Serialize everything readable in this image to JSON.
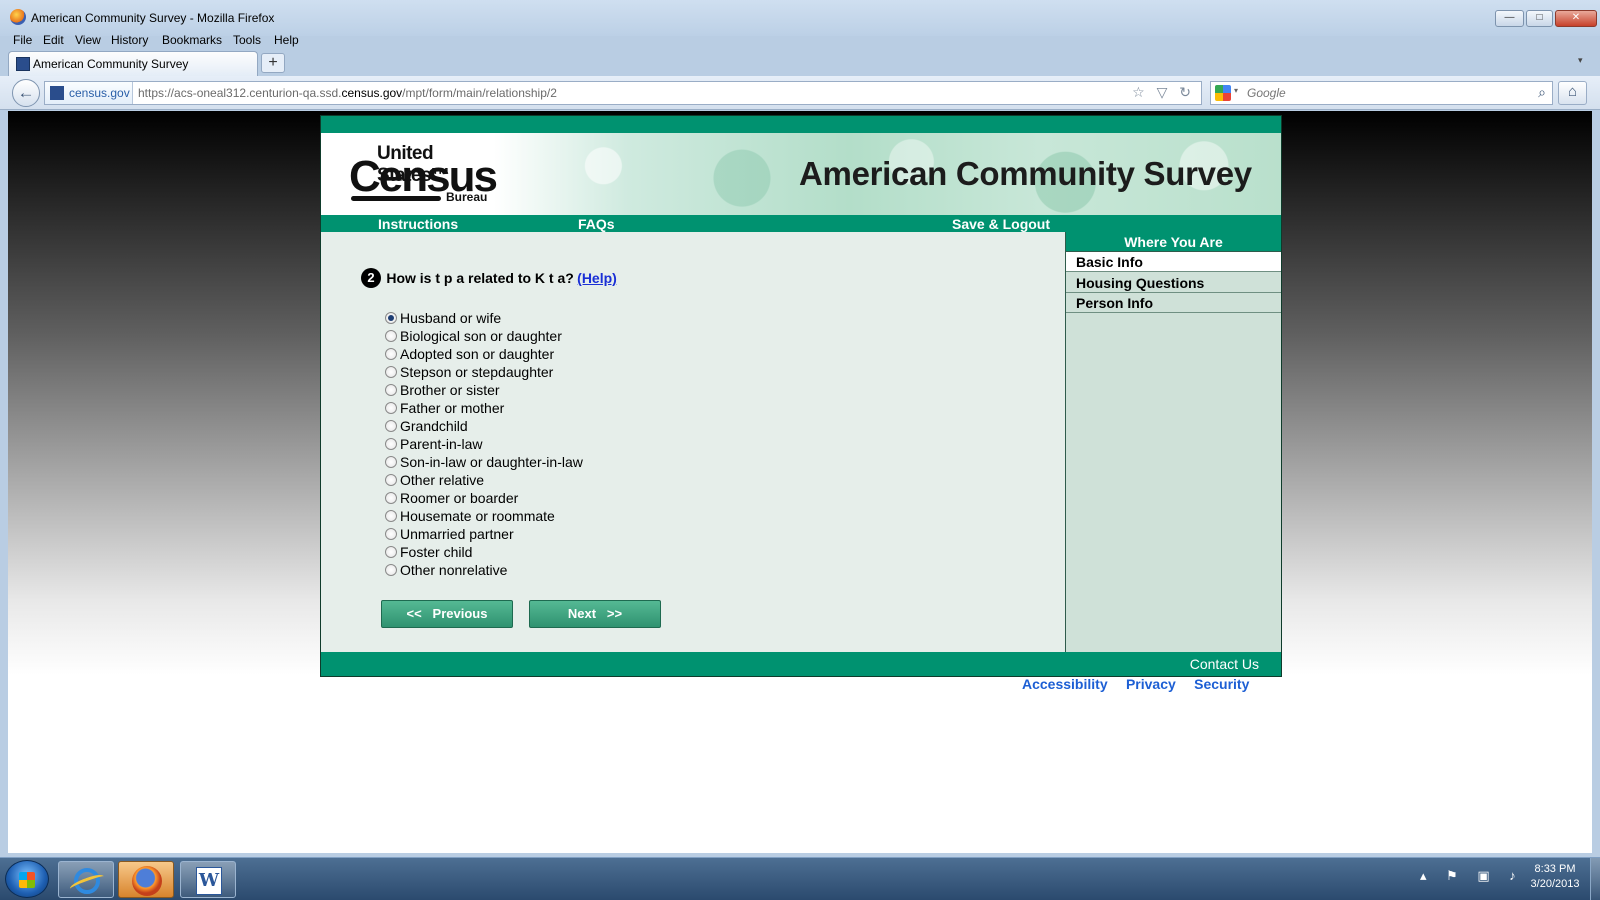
{
  "window": {
    "title": "American Community Survey - Mozilla Firefox",
    "min": "—",
    "max": "□",
    "close": "✕"
  },
  "menu": {
    "file": "File",
    "edit": "Edit",
    "view": "View",
    "history": "History",
    "bookmarks": "Bookmarks",
    "tools": "Tools",
    "help": "Help"
  },
  "tab": {
    "label": "American Community Survey",
    "new_tab": "+",
    "list_arrow": "▾"
  },
  "nav": {
    "back": "←",
    "site_identity": "census.gov",
    "url_prefix": "https://acs-oneal312.centurion-qa.ssd.",
    "url_domain": "census.gov",
    "url_suffix": "/mpt/form/main/relationship/2",
    "url_icons": "☆ ▽ ↻",
    "search_placeholder": "Google",
    "search_caret": "▾",
    "search_icon": "⌕",
    "home": "⌂"
  },
  "census": {
    "logo_top": "United States™",
    "logo_main": "Census",
    "logo_bottom": "Bureau",
    "banner_title": "American Community Survey",
    "nav": {
      "instructions": "Instructions",
      "faqs": "FAQs",
      "save_logout": "Save & Logout"
    },
    "question": {
      "number": "2",
      "text": "How is t p a related to K t a?",
      "help": "(Help)"
    },
    "options": [
      "Husband or wife",
      "Biological son or daughter",
      "Adopted son or daughter",
      "Stepson or stepdaughter",
      "Brother or sister",
      "Father or mother",
      "Grandchild",
      "Parent-in-law",
      "Son-in-law or daughter-in-law",
      "Other relative",
      "Roomer or boarder",
      "Housemate or roommate",
      "Unmarried partner",
      "Foster child",
      "Other nonrelative"
    ],
    "selected_option": "Husband or wife",
    "buttons": {
      "previous": "<<   Previous",
      "next": "Next   >>"
    },
    "sidebar": {
      "title": "Where You Are",
      "items": [
        "Basic Info",
        "Housing Questions",
        "Person Info"
      ],
      "active": "Basic Info"
    },
    "footer": {
      "contact": "Contact Us",
      "links": [
        "Accessibility",
        "Privacy",
        "Security"
      ]
    }
  },
  "taskbar": {
    "word_letter": "W",
    "tray_icons": "▴ ⚑ ▣ ♪",
    "time": "8:33 PM",
    "date": "3/20/2013"
  },
  "colors": {
    "census_green": "#009270",
    "link_blue": "#1a2fd6",
    "footer_link_blue": "#1d5fd4"
  }
}
